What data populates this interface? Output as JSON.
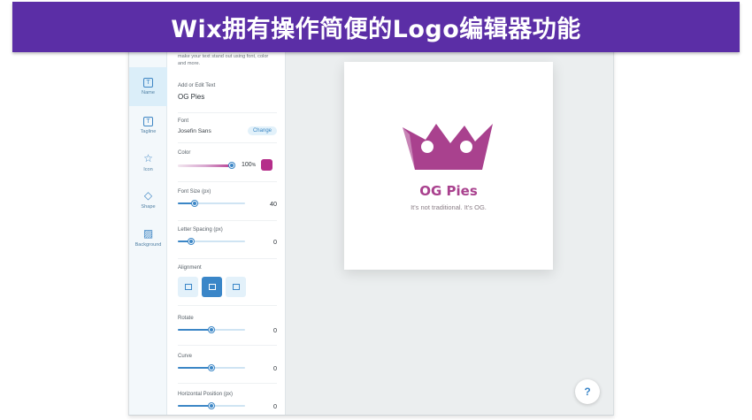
{
  "banner": {
    "title": "Wix拥有操作简便的Logo编辑器功能"
  },
  "rail": {
    "items": [
      {
        "label": "Name",
        "icon": "text-box-icon",
        "glyph": "T",
        "active": true
      },
      {
        "label": "Tagline",
        "icon": "tagline-box-icon",
        "glyph": "T",
        "active": false
      },
      {
        "label": "Icon",
        "icon": "star-icon",
        "glyph": "☆",
        "active": false
      },
      {
        "label": "Shape",
        "icon": "diamond-icon",
        "glyph": "◇",
        "active": false
      },
      {
        "label": "Background",
        "icon": "background-hatch-icon",
        "glyph": "▨",
        "active": false
      }
    ]
  },
  "panel": {
    "hint": "make your text stand out using font, color and more.",
    "text": {
      "label": "Add or Edit Text",
      "value": "OG Pies"
    },
    "font": {
      "label": "Font",
      "value": "Josefin Sans",
      "change_label": "Change"
    },
    "color": {
      "label": "Color",
      "opacity": "100",
      "opacity_unit": "%",
      "swatch": "#b52e8a"
    },
    "font_size": {
      "label": "Font Size (px)",
      "value": "40",
      "fraction": 0.25
    },
    "letter_spacing": {
      "label": "Letter Spacing (px)",
      "value": "0",
      "fraction": 0.2
    },
    "alignment": {
      "label": "Alignment",
      "options": [
        "left",
        "center",
        "right"
      ],
      "selected": "center"
    },
    "rotate": {
      "label": "Rotate",
      "value": "0",
      "fraction": 0.5
    },
    "curve": {
      "label": "Curve",
      "value": "0",
      "fraction": 0.5
    },
    "horizontal_position": {
      "label": "Horizontal Position (px)",
      "value": "0",
      "fraction": 0.5
    }
  },
  "logo": {
    "name": "OG Pies",
    "tagline": "It's not traditional. It's OG.",
    "crown_color": "#a9418e"
  },
  "help": {
    "label": "?"
  },
  "colors": {
    "accent": "#3a86c8",
    "banner": "#5b2ea6",
    "brand": "#a9418e"
  }
}
